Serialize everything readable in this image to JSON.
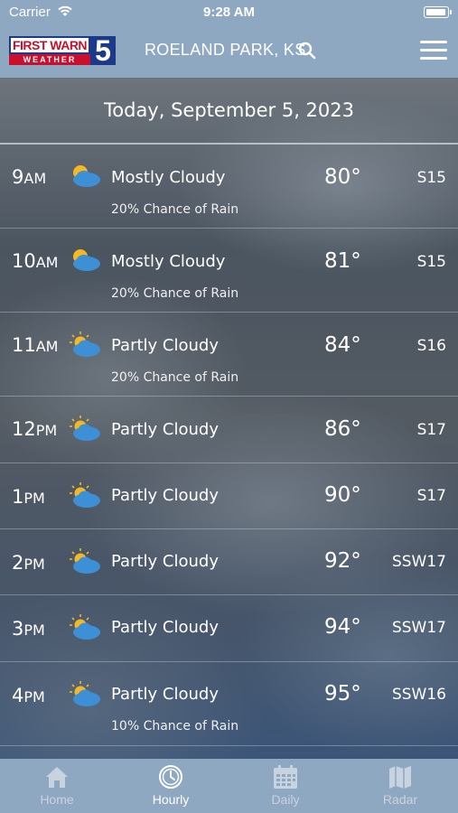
{
  "status_bar": {
    "carrier": "Carrier",
    "time": "9:28 AM"
  },
  "header": {
    "logo_line1": "FIRST WARN",
    "logo_line2": "WEATHER",
    "logo_number": "5",
    "location": "ROELAND PARK, KS"
  },
  "date_title": "Today, September 5, 2023",
  "hours": [
    {
      "time": "9",
      "ampm": "AM",
      "icon": "mostly-cloudy-icon",
      "condition": "Mostly Cloudy",
      "rain": "20% Chance of Rain",
      "temp": "80°",
      "wind": "S15"
    },
    {
      "time": "10",
      "ampm": "AM",
      "icon": "mostly-cloudy-icon",
      "condition": "Mostly Cloudy",
      "rain": "20% Chance of Rain",
      "temp": "81°",
      "wind": "S15"
    },
    {
      "time": "11",
      "ampm": "AM",
      "icon": "partly-cloudy-icon",
      "condition": "Partly Cloudy",
      "rain": "20% Chance of Rain",
      "temp": "84°",
      "wind": "S16"
    },
    {
      "time": "12",
      "ampm": "PM",
      "icon": "partly-cloudy-icon",
      "condition": "Partly Cloudy",
      "rain": "",
      "temp": "86°",
      "wind": "S17"
    },
    {
      "time": "1",
      "ampm": "PM",
      "icon": "partly-cloudy-icon",
      "condition": "Partly Cloudy",
      "rain": "",
      "temp": "90°",
      "wind": "S17"
    },
    {
      "time": "2",
      "ampm": "PM",
      "icon": "partly-cloudy-icon",
      "condition": "Partly Cloudy",
      "rain": "",
      "temp": "92°",
      "wind": "SSW17"
    },
    {
      "time": "3",
      "ampm": "PM",
      "icon": "partly-cloudy-icon",
      "condition": "Partly Cloudy",
      "rain": "",
      "temp": "94°",
      "wind": "SSW17"
    },
    {
      "time": "4",
      "ampm": "PM",
      "icon": "partly-cloudy-icon",
      "condition": "Partly Cloudy",
      "rain": "10% Chance of Rain",
      "temp": "95°",
      "wind": "SSW16"
    }
  ],
  "tabs": [
    {
      "label": "Home",
      "icon": "home-icon",
      "active": false
    },
    {
      "label": "Hourly",
      "icon": "clock-icon",
      "active": true
    },
    {
      "label": "Daily",
      "icon": "calendar-icon",
      "active": false
    },
    {
      "label": "Radar",
      "icon": "map-icon",
      "active": false
    }
  ],
  "colors": {
    "bar": "#8fa8c2",
    "sun": "#f5b820",
    "cloud": "#3d8fd6"
  }
}
